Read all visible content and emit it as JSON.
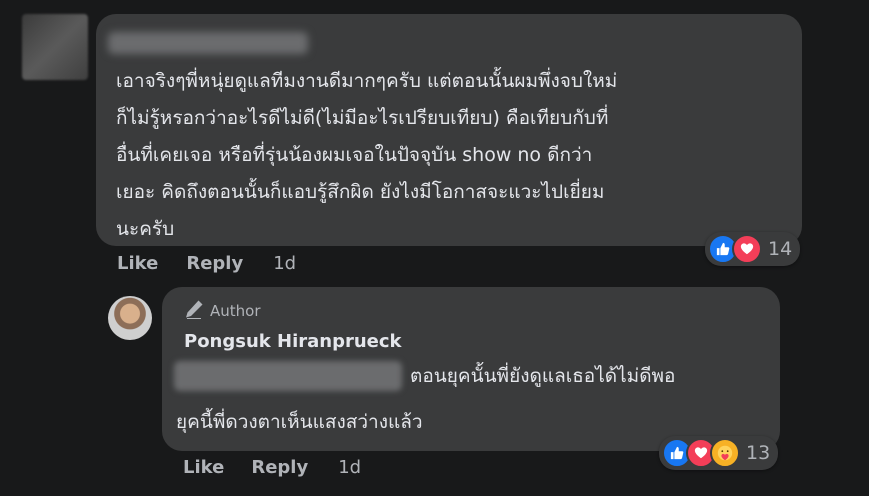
{
  "comment": {
    "lines": [
      "เอาจริงๆพี่หนุ่ยดูแลทีมงานดีมากๆครับ แต่ตอนนั้นผมพึ่งจบใหม่",
      "ก็ไม่รู้หรอกว่าอะไรดีไม่ดี(ไม่มีอะไรเปรียบเทียบ) คือเทียบกับที่",
      "อื่นที่เคยเจอ หรือที่รุ่นน้องผมเจอในปัจจุบัน show no ดีกว่า",
      "เยอะ คิดถึงตอนนั้นก็แอบรู้สึกผิด ยังไงมีโอกาสจะแวะไปเยี่ยม",
      "นะครับ"
    ],
    "actions": {
      "like": "Like",
      "reply": "Reply",
      "time": "1d"
    },
    "reactions": {
      "icons": [
        "like-icon",
        "love-icon"
      ],
      "count": "14"
    }
  },
  "reply": {
    "badge": "Author",
    "author_name": "Pongsuk Hiranprueck",
    "line1": "ตอนยุคนั้นพี่ยังดูแลเธอได้ไม่ดีพอ",
    "line2": "ยุคนี้พี่ดวงตาเห็นแสงสว่างแล้ว",
    "actions": {
      "like": "Like",
      "reply": "Reply",
      "time": "1d"
    },
    "reactions": {
      "icons": [
        "like-icon",
        "love-icon",
        "care-icon"
      ],
      "count": "13"
    }
  },
  "colors": {
    "background": "#18191a",
    "bubble": "#3a3b3c",
    "text": "#e4e6eb",
    "muted": "#b0b3b8",
    "like": "#1877f2",
    "love": "#f33e58",
    "care": "#f7b125"
  }
}
